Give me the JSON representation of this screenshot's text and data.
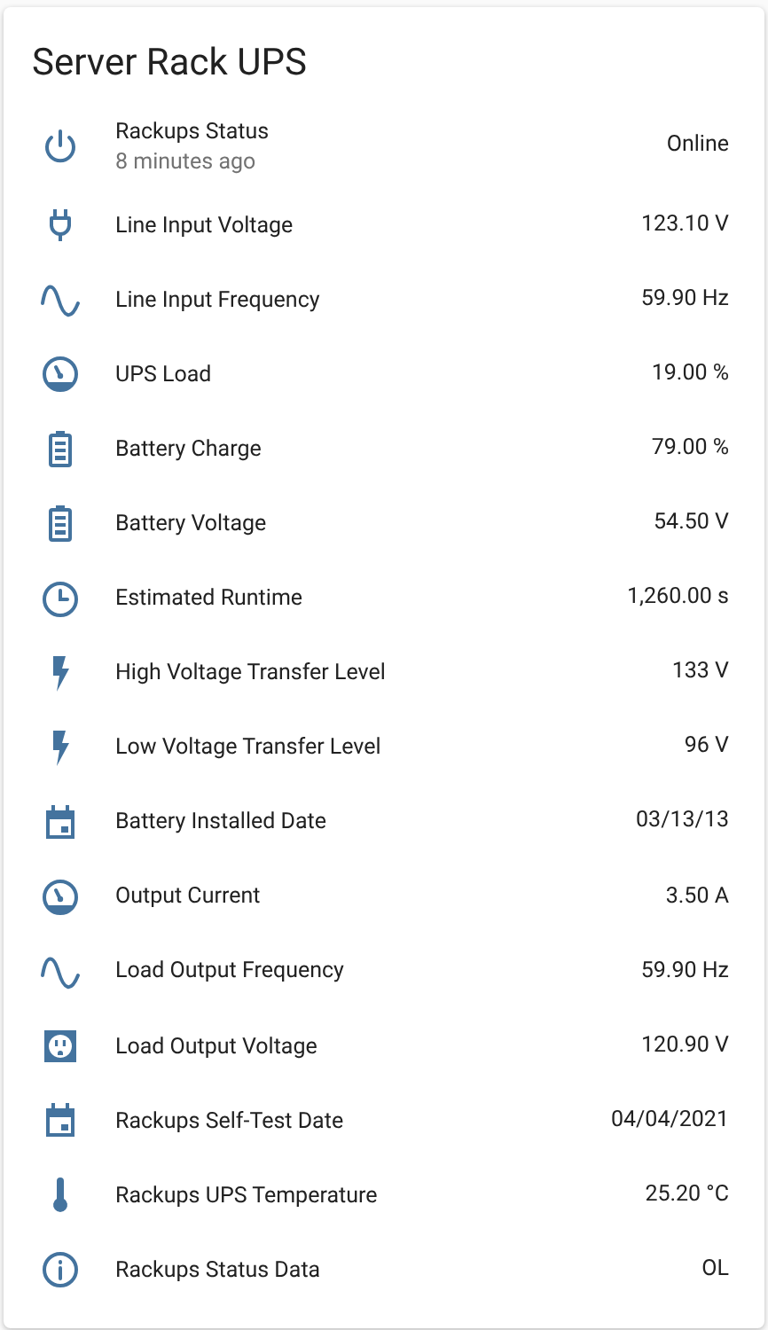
{
  "card": {
    "title": "Server Rack UPS"
  },
  "rows": [
    {
      "kind": "power",
      "name": "Rackups Status",
      "secondary": "8 minutes ago",
      "value": "Online"
    },
    {
      "kind": "plug",
      "name": "Line Input Voltage",
      "value": "123.10 V"
    },
    {
      "kind": "sine",
      "name": "Line Input Frequency",
      "value": "59.90 Hz"
    },
    {
      "kind": "gauge",
      "name": "UPS Load",
      "value": "19.00 %"
    },
    {
      "kind": "battery",
      "name": "Battery Charge",
      "value": "79.00 %"
    },
    {
      "kind": "battery",
      "name": "Battery Voltage",
      "value": "54.50 V"
    },
    {
      "kind": "clock",
      "name": "Estimated Runtime",
      "value": "1,260.00 s"
    },
    {
      "kind": "bolt",
      "name": "High Voltage Transfer Level",
      "value": "133 V"
    },
    {
      "kind": "bolt",
      "name": "Low Voltage Transfer Level",
      "value": "96 V"
    },
    {
      "kind": "calendar",
      "name": "Battery Installed Date",
      "value": "03/13/13"
    },
    {
      "kind": "gauge",
      "name": "Output Current",
      "value": "3.50 A"
    },
    {
      "kind": "sine",
      "name": "Load Output Frequency",
      "value": "59.90 Hz"
    },
    {
      "kind": "outlet",
      "name": "Load Output Voltage",
      "value": "120.90 V"
    },
    {
      "kind": "calendar",
      "name": "Rackups Self-Test Date",
      "value": "04/04/2021"
    },
    {
      "kind": "thermometer",
      "name": "Rackups UPS Temperature",
      "value": "25.20 °C"
    },
    {
      "kind": "info",
      "name": "Rackups Status Data",
      "value": "OL"
    }
  ]
}
